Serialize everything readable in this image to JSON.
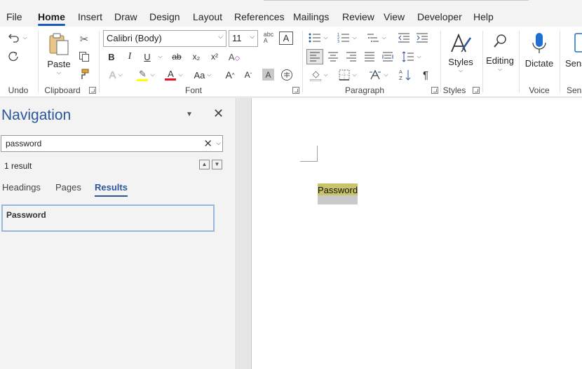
{
  "tabs": [
    "File",
    "Home",
    "Insert",
    "Draw",
    "Design",
    "Layout",
    "References",
    "Mailings",
    "Review",
    "View",
    "Developer",
    "Help"
  ],
  "ribbon": {
    "groups": {
      "undo": "Undo",
      "clipboard": "Clipboard",
      "font": "Font",
      "paragraph": "Paragraph",
      "styles": "Styles",
      "voice": "Voice",
      "sensitivity": "Sens"
    },
    "paste_label": "Paste",
    "font_name": "Calibri (Body)",
    "font_size": "11",
    "styles_label": "Styles",
    "editing_label": "Editing",
    "dictate_label": "Dictate",
    "sens_label": "Sens",
    "bold": "B",
    "italic": "I",
    "underline": "U",
    "strike": "ab",
    "subscript": "x₂",
    "superscript": "x²",
    "grow_font": "A",
    "shrink_font": "A",
    "change_case": "Aa",
    "pilcrow": "¶"
  },
  "navigation": {
    "title": "Navigation",
    "search_value": "password",
    "result_count": "1 result",
    "tabs": [
      "Headings",
      "Pages",
      "Results"
    ],
    "result_item": "Password"
  },
  "document": {
    "highlighted_word": "Password"
  },
  "colors": {
    "accent": "#185abd",
    "nav_title": "#2b579a",
    "highlight": "#c9c36a"
  }
}
